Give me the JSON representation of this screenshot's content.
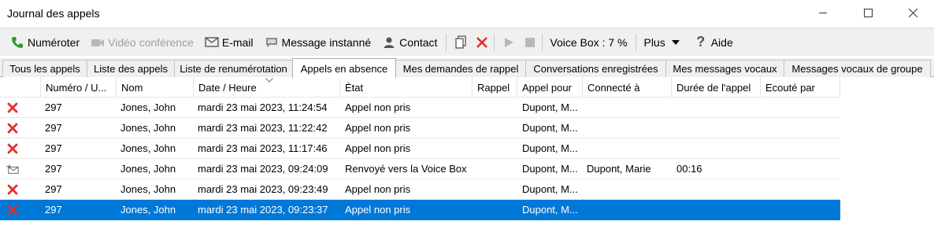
{
  "window": {
    "title": "Journal des appels"
  },
  "toolbar": {
    "dial": "Numéroter",
    "video": "Vidéo conférence",
    "email": "E-mail",
    "im": "Message instanné",
    "contact": "Contact",
    "voicebox": "Voice Box : 7 %",
    "more": "Plus",
    "help": "Aide"
  },
  "tabs": [
    {
      "label": "Tous les appels"
    },
    {
      "label": "Liste des appels"
    },
    {
      "label": "Liste de renumérotation"
    },
    {
      "label": "Appels en absence",
      "active": true
    },
    {
      "label": "Mes demandes de rappel"
    },
    {
      "label": "Conversations enregistrées"
    },
    {
      "label": "Mes messages vocaux"
    },
    {
      "label": "Messages vocaux de groupe"
    }
  ],
  "columns": [
    "Numéro / U...",
    "Nom",
    "Date / Heure",
    "État",
    "Rappel",
    "Appel pour",
    "Connecté à",
    "Durée de l'appel",
    "Ecouté par"
  ],
  "rows": [
    {
      "icon": "missed-call-icon",
      "number": "297",
      "name": "Jones, John",
      "datetime": "mardi 23 mai 2023, 11:24:54",
      "state": "Appel non pris",
      "callback": "",
      "for": "Dupont, M...",
      "connected": "",
      "duration": "",
      "listened": ""
    },
    {
      "icon": "missed-call-icon",
      "number": "297",
      "name": "Jones, John",
      "datetime": "mardi 23 mai 2023, 11:22:42",
      "state": "Appel non pris",
      "callback": "",
      "for": "Dupont, M...",
      "connected": "",
      "duration": "",
      "listened": ""
    },
    {
      "icon": "missed-call-icon",
      "number": "297",
      "name": "Jones, John",
      "datetime": "mardi 23 mai 2023, 11:17:46",
      "state": "Appel non pris",
      "callback": "",
      "for": "Dupont, M...",
      "connected": "",
      "duration": "",
      "listened": ""
    },
    {
      "icon": "voicebox-forward-icon",
      "number": "297",
      "name": "Jones, John",
      "datetime": "mardi 23 mai 2023, 09:24:09",
      "state": "Renvoyé vers la Voice Box",
      "callback": "",
      "for": "Dupont, M...",
      "connected": "Dupont, Marie",
      "duration": "00:16",
      "listened": ""
    },
    {
      "icon": "missed-call-icon",
      "number": "297",
      "name": "Jones, John",
      "datetime": "mardi 23 mai 2023, 09:23:49",
      "state": "Appel non pris",
      "callback": "",
      "for": "Dupont, M...",
      "connected": "",
      "duration": "",
      "listened": ""
    },
    {
      "icon": "missed-call-icon",
      "number": "297",
      "name": "Jones, John",
      "datetime": "mardi 23 mai 2023, 09:23:37",
      "state": "Appel non pris",
      "callback": "",
      "for": "Dupont, M...",
      "connected": "",
      "duration": "",
      "listened": "",
      "selected": true
    }
  ],
  "colors": {
    "selection": "#0078d7",
    "missed": "#e03030",
    "phone_green": "#2e9a2e"
  }
}
